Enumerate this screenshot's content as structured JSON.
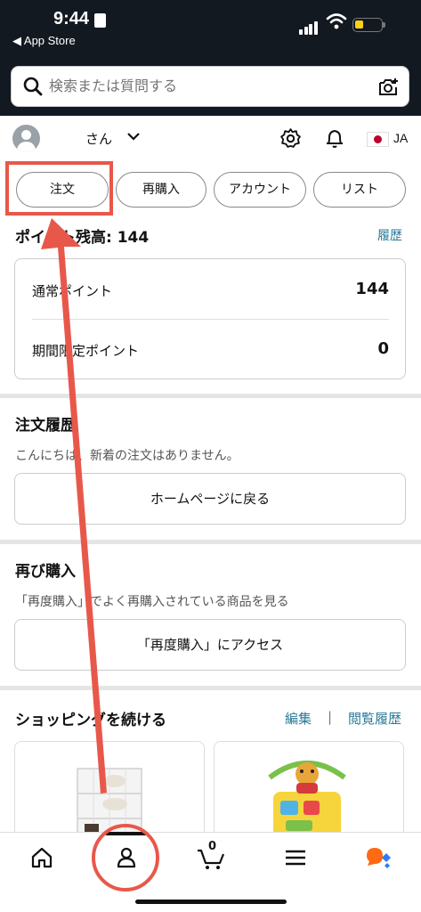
{
  "status_bar": {
    "time": "9:44",
    "back_label": "◀ App Store"
  },
  "search": {
    "placeholder": "検索または質問する"
  },
  "account": {
    "username": "さん",
    "language": "JA"
  },
  "tabs": [
    {
      "label": "注文"
    },
    {
      "label": "再購入"
    },
    {
      "label": "アカウント"
    },
    {
      "label": "リスト"
    }
  ],
  "points": {
    "title": "ポイント残高: 144",
    "history_link": "履歴",
    "rows": [
      {
        "label": "通常ポイント",
        "value": "144"
      },
      {
        "label": "期間限定ポイント",
        "value": "0"
      }
    ]
  },
  "orders": {
    "title": "注文履歴",
    "message": "こんにちは、新着の注文はありません。",
    "button": "ホームページに戻る"
  },
  "rebuy": {
    "title": "再び購入",
    "message": "「再度購入」でよく再購入されている商品を見る",
    "button": "「再度購入」にアクセス"
  },
  "continue_shopping": {
    "title": "ショッピングを続ける",
    "edit_link": "編集",
    "separator": "|",
    "history_link": "閲覧履歴"
  },
  "bottom_nav": {
    "items": [
      "home-icon",
      "account-icon",
      "cart-icon",
      "menu-icon",
      "ai-assistant-icon"
    ],
    "cart_count": "0",
    "active": "account-icon"
  },
  "colors": {
    "header_bg": "#131921",
    "link": "#2a7a9a",
    "annotation": "#e8584a",
    "assistant_orange": "#ff6a13",
    "assistant_blue": "#2e7cf6"
  }
}
